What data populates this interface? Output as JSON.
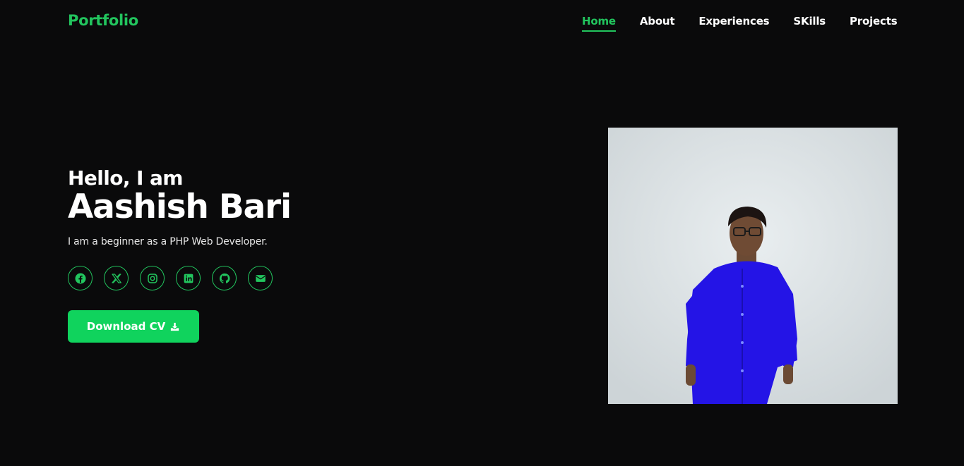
{
  "header": {
    "logo": "Portfolio",
    "nav": [
      {
        "label": "Home",
        "active": true
      },
      {
        "label": "About",
        "active": false
      },
      {
        "label": "Experiences",
        "active": false
      },
      {
        "label": "SKills",
        "active": false
      },
      {
        "label": "Projects",
        "active": false
      }
    ]
  },
  "hero": {
    "greeting": "Hello, I am",
    "name": "Aashish Bari",
    "tagline": "I am a beginner as a PHP Web Developer.",
    "socials": [
      {
        "icon": "facebook-icon"
      },
      {
        "icon": "x-twitter-icon"
      },
      {
        "icon": "instagram-icon"
      },
      {
        "icon": "linkedin-icon"
      },
      {
        "icon": "github-icon"
      },
      {
        "icon": "envelope-icon"
      }
    ],
    "cv_button": "Download CV",
    "cv_icon": "download-icon"
  },
  "colors": {
    "accent": "#22c55e",
    "button": "#10d35d",
    "background": "#0a0a0b"
  }
}
